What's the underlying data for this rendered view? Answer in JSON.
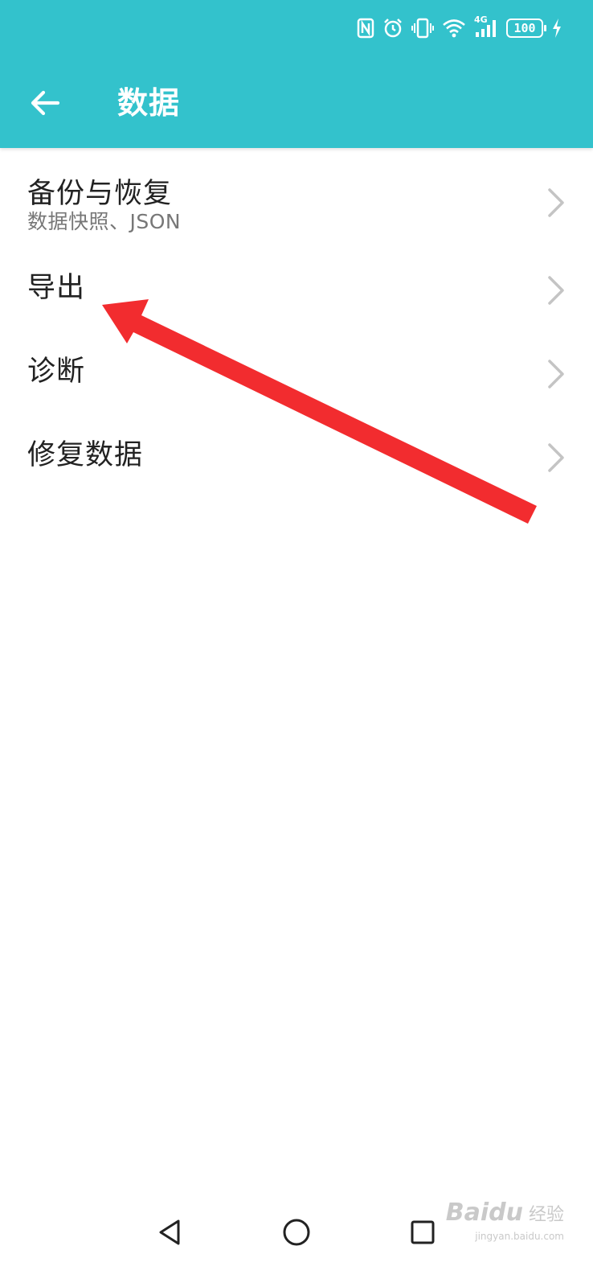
{
  "status_bar": {
    "icons": [
      "nfc-icon",
      "alarm-icon",
      "vibrate-icon",
      "wifi-icon",
      "signal-4g-icon",
      "battery-icon",
      "charging-icon"
    ],
    "network_label": "4G",
    "battery_level": "100"
  },
  "header": {
    "title": "数据",
    "back_icon": "back-arrow-icon",
    "background_color": "#33c2cc"
  },
  "menu": {
    "items": [
      {
        "label": "备份与恢复",
        "subtitle": "数据快照、JSON"
      },
      {
        "label": "导出"
      },
      {
        "label": "诊断"
      },
      {
        "label": "修复数据"
      }
    ]
  },
  "annotation": {
    "color": "#f22c2f"
  },
  "nav_bar": {
    "icons": [
      "back-triangle-icon",
      "home-circle-icon",
      "recents-square-icon"
    ]
  },
  "watermark": {
    "brand": "Bai",
    "brand_suffix": "du",
    "label": "经验",
    "url": "jingyan.baidu.com"
  }
}
